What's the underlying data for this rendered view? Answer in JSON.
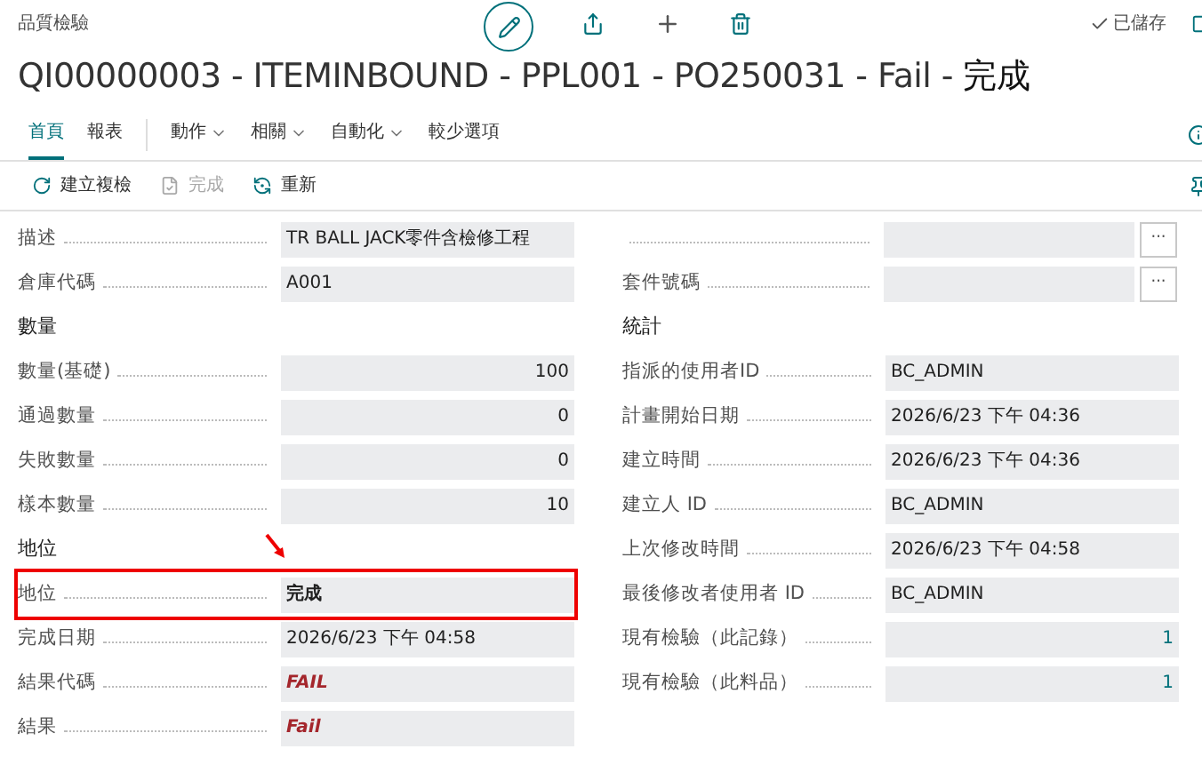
{
  "breadcrumb": "品質檢驗",
  "saved": "已儲存",
  "title": {
    "text": "QI00000003 - ITEMINBOUND - PPL001 - PO250031 - Fail - ",
    "status": "完成"
  },
  "tabs": [
    {
      "label": "首頁",
      "selected": true,
      "menu": false
    },
    {
      "label": "報表",
      "selected": false,
      "menu": false
    },
    {
      "label": "動作",
      "selected": false,
      "menu": true
    },
    {
      "label": "相關",
      "selected": false,
      "menu": true
    },
    {
      "label": "自動化",
      "selected": false,
      "menu": true
    },
    {
      "label": "較少選項",
      "selected": false,
      "menu": false
    }
  ],
  "actions": [
    {
      "label": "建立複檢",
      "kind": "refresh",
      "disabled": false
    },
    {
      "label": "完成",
      "kind": "document",
      "disabled": true
    },
    {
      "label": "重新",
      "kind": "restart",
      "disabled": false
    }
  ],
  "left": [
    {
      "kind": "text",
      "label": "描述",
      "value": "TR BALL JACK零件含檢修工程"
    },
    {
      "kind": "text",
      "label": "倉庫代碼",
      "value": "A001"
    },
    {
      "kind": "heading",
      "label": "數量"
    },
    {
      "kind": "number",
      "label": "數量(基礎)",
      "value": "100"
    },
    {
      "kind": "number",
      "label": "通過數量",
      "value": "0"
    },
    {
      "kind": "number",
      "label": "失敗數量",
      "value": "0"
    },
    {
      "kind": "number",
      "label": "樣本數量",
      "value": "10"
    },
    {
      "kind": "heading",
      "label": "地位"
    },
    {
      "kind": "bold",
      "label": "地位",
      "value": "完成",
      "highlighted": true
    },
    {
      "kind": "text",
      "label": "完成日期",
      "value": "2026/6/23 下午 04:58"
    },
    {
      "kind": "fail",
      "label": "結果代碼",
      "value": "FAIL"
    },
    {
      "kind": "fail",
      "label": "結果",
      "value": "Fail"
    }
  ],
  "right": [
    {
      "kind": "lookup",
      "button": "···"
    },
    {
      "kind": "lookup",
      "label": "套件號碼",
      "button": "···"
    },
    {
      "kind": "heading",
      "label": "統計"
    },
    {
      "kind": "text",
      "label": "指派的使用者ID",
      "value": "BC_ADMIN"
    },
    {
      "kind": "text",
      "label": "計畫開始日期",
      "value": "2026/6/23 下午 04:36"
    },
    {
      "kind": "text",
      "label": "建立時間",
      "value": "2026/6/23 下午 04:36"
    },
    {
      "kind": "text",
      "label": "建立人 ID",
      "value": "BC_ADMIN"
    },
    {
      "kind": "text",
      "label": "上次修改時間",
      "value": "2026/6/23 下午 04:58"
    },
    {
      "kind": "text",
      "label": "最後修改者使用者 ID",
      "value": "BC_ADMIN"
    },
    {
      "kind": "link",
      "label": "現有檢驗（此記錄）",
      "value": "1"
    },
    {
      "kind": "link",
      "label": "現有檢驗（此料品）",
      "value": "1"
    }
  ]
}
